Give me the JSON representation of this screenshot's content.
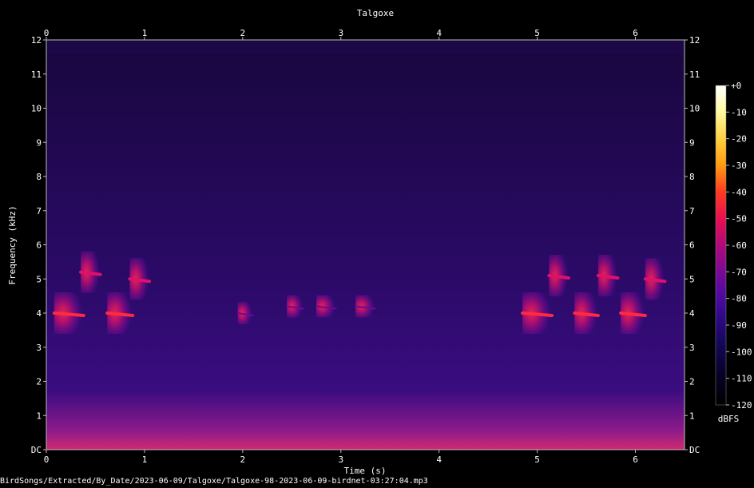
{
  "chart_data": {
    "type": "heatmap",
    "title": "Talgoxe",
    "xlabel": "Time (s)",
    "ylabel": "Frequency (kHz)",
    "xlim": [
      0,
      6.5
    ],
    "ylim": [
      0,
      12
    ],
    "x_ticks": [
      "0",
      "1",
      "2",
      "3",
      "4",
      "5",
      "6"
    ],
    "y_ticks": [
      "DC",
      "1",
      "2",
      "3",
      "4",
      "5",
      "6",
      "7",
      "8",
      "9",
      "10",
      "11",
      "12"
    ],
    "colorbar": {
      "label": "dBFS",
      "range": [
        -120,
        0
      ],
      "ticks": [
        "+0",
        "-10",
        "-20",
        "-30",
        "-40",
        "-50",
        "-60",
        "-70",
        "-80",
        "-90",
        "-100",
        "-110",
        "-120"
      ],
      "colors": [
        "#ffffff",
        "#fff9a0",
        "#ffd040",
        "#ff9a10",
        "#ff3a20",
        "#e81050",
        "#b00a78",
        "#7a0a96",
        "#4a0aa0",
        "#25087a",
        "#10064a",
        "#050220",
        "#000000"
      ]
    },
    "background_noise_floor_khz": [
      0,
      11.6
    ],
    "song_notes": [
      {
        "start_s": 0.08,
        "end_s": 0.38,
        "freq_khz": 4.0,
        "level_db": -50
      },
      {
        "start_s": 0.35,
        "end_s": 0.55,
        "freq_khz": 5.2,
        "level_db": -55
      },
      {
        "start_s": 0.62,
        "end_s": 0.88,
        "freq_khz": 4.0,
        "level_db": -50
      },
      {
        "start_s": 0.85,
        "end_s": 1.05,
        "freq_khz": 5.0,
        "level_db": -55
      },
      {
        "start_s": 1.95,
        "end_s": 2.1,
        "freq_khz": 4.0,
        "level_db": -80
      },
      {
        "start_s": 2.45,
        "end_s": 2.62,
        "freq_khz": 4.2,
        "level_db": -80
      },
      {
        "start_s": 2.75,
        "end_s": 2.95,
        "freq_khz": 4.2,
        "level_db": -80
      },
      {
        "start_s": 3.15,
        "end_s": 3.35,
        "freq_khz": 4.2,
        "level_db": -80
      },
      {
        "start_s": 4.85,
        "end_s": 5.15,
        "freq_khz": 4.0,
        "level_db": -45
      },
      {
        "start_s": 5.12,
        "end_s": 5.32,
        "freq_khz": 5.1,
        "level_db": -55
      },
      {
        "start_s": 5.38,
        "end_s": 5.62,
        "freq_khz": 4.0,
        "level_db": -45
      },
      {
        "start_s": 5.62,
        "end_s": 5.82,
        "freq_khz": 5.1,
        "level_db": -55
      },
      {
        "start_s": 5.85,
        "end_s": 6.1,
        "freq_khz": 4.0,
        "level_db": -45
      },
      {
        "start_s": 6.1,
        "end_s": 6.3,
        "freq_khz": 5.0,
        "level_db": -55
      }
    ]
  },
  "footer": {
    "path": "BirdSongs/Extracted/By_Date/2023-06-09/Talgoxe/Talgoxe-98-2023-06-09-birdnet-03:27:04.mp3"
  }
}
